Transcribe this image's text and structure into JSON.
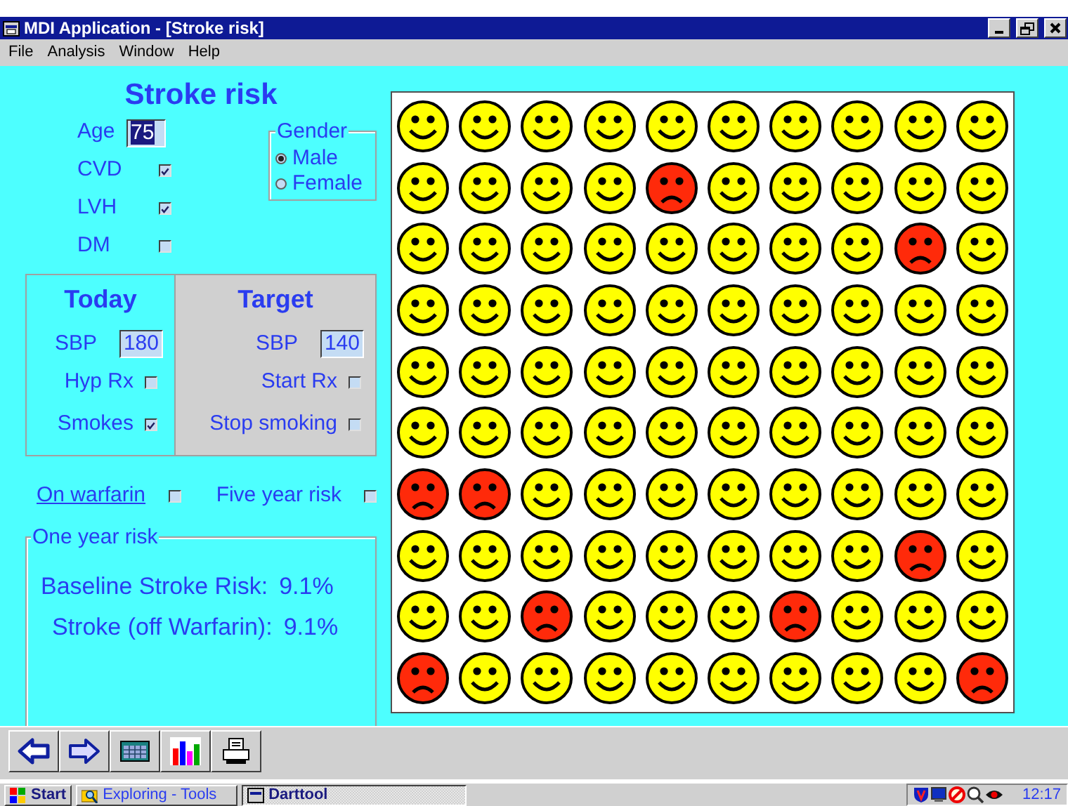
{
  "window": {
    "title": "MDI Application - [Stroke risk]"
  },
  "menu": [
    "File",
    "Analysis",
    "Window",
    "Help"
  ],
  "form": {
    "title": "Stroke risk",
    "age": {
      "label": "Age",
      "value": "75",
      "selected": true
    },
    "conditions": [
      {
        "label": "CVD",
        "checked": true
      },
      {
        "label": "LVH",
        "checked": true
      },
      {
        "label": "DM",
        "checked": false
      }
    ],
    "gender": {
      "legend": "Gender",
      "options": [
        {
          "label": "Male",
          "selected": true
        },
        {
          "label": "Female",
          "selected": false
        }
      ]
    },
    "today": {
      "heading": "Today",
      "sbp": {
        "label": "SBP",
        "value": "180"
      },
      "options": [
        {
          "label": "Hyp Rx",
          "checked": false
        },
        {
          "label": "Smokes",
          "checked": true
        }
      ]
    },
    "target": {
      "heading": "Target",
      "sbp": {
        "label": "SBP",
        "value": "140"
      },
      "options": [
        {
          "label": "Start Rx",
          "checked": false
        },
        {
          "label": "Stop smoking",
          "checked": false
        }
      ]
    },
    "extras": [
      {
        "label": "On warfarin",
        "kind": "link",
        "checked": false
      },
      {
        "label": "Five year risk",
        "kind": "text",
        "checked": false
      }
    ],
    "one_year_risk": {
      "legend": "One year risk",
      "lines": [
        {
          "label": "Baseline Stroke Risk:",
          "value": "9.1%"
        },
        {
          "label": "Stroke (off Warfarin):",
          "value": "9.1%"
        }
      ]
    }
  },
  "faces": [
    [
      {
        "sad": false
      },
      {
        "sad": false
      },
      {
        "sad": false
      },
      {
        "sad": false
      },
      {
        "sad": false
      },
      {
        "sad": false
      },
      {
        "sad": false
      },
      {
        "sad": false
      },
      {
        "sad": false
      },
      {
        "sad": false
      }
    ],
    [
      {
        "sad": false
      },
      {
        "sad": false
      },
      {
        "sad": false
      },
      {
        "sad": false
      },
      {
        "sad": true
      },
      {
        "sad": false
      },
      {
        "sad": false
      },
      {
        "sad": false
      },
      {
        "sad": false
      },
      {
        "sad": false
      }
    ],
    [
      {
        "sad": false
      },
      {
        "sad": false
      },
      {
        "sad": false
      },
      {
        "sad": false
      },
      {
        "sad": false
      },
      {
        "sad": false
      },
      {
        "sad": false
      },
      {
        "sad": false
      },
      {
        "sad": true
      },
      {
        "sad": false
      }
    ],
    [
      {
        "sad": false
      },
      {
        "sad": false
      },
      {
        "sad": false
      },
      {
        "sad": false
      },
      {
        "sad": false
      },
      {
        "sad": false
      },
      {
        "sad": false
      },
      {
        "sad": false
      },
      {
        "sad": false
      },
      {
        "sad": false
      }
    ],
    [
      {
        "sad": false
      },
      {
        "sad": false
      },
      {
        "sad": false
      },
      {
        "sad": false
      },
      {
        "sad": false
      },
      {
        "sad": false
      },
      {
        "sad": false
      },
      {
        "sad": false
      },
      {
        "sad": false
      },
      {
        "sad": false
      }
    ],
    [
      {
        "sad": false
      },
      {
        "sad": false
      },
      {
        "sad": false
      },
      {
        "sad": false
      },
      {
        "sad": false
      },
      {
        "sad": false
      },
      {
        "sad": false
      },
      {
        "sad": false
      },
      {
        "sad": false
      },
      {
        "sad": false
      }
    ],
    [
      {
        "sad": true
      },
      {
        "sad": true
      },
      {
        "sad": false
      },
      {
        "sad": false
      },
      {
        "sad": false
      },
      {
        "sad": false
      },
      {
        "sad": false
      },
      {
        "sad": false
      },
      {
        "sad": false
      },
      {
        "sad": false
      }
    ],
    [
      {
        "sad": false
      },
      {
        "sad": false
      },
      {
        "sad": false
      },
      {
        "sad": false
      },
      {
        "sad": false
      },
      {
        "sad": false
      },
      {
        "sad": false
      },
      {
        "sad": false
      },
      {
        "sad": true
      },
      {
        "sad": false
      }
    ],
    [
      {
        "sad": false
      },
      {
        "sad": false
      },
      {
        "sad": true
      },
      {
        "sad": false
      },
      {
        "sad": false
      },
      {
        "sad": false
      },
      {
        "sad": true
      },
      {
        "sad": false
      },
      {
        "sad": false
      },
      {
        "sad": false
      }
    ],
    [
      {
        "sad": true
      },
      {
        "sad": false
      },
      {
        "sad": false
      },
      {
        "sad": false
      },
      {
        "sad": false
      },
      {
        "sad": false
      },
      {
        "sad": false
      },
      {
        "sad": false
      },
      {
        "sad": false
      },
      {
        "sad": true
      }
    ]
  ],
  "toolbar": [
    {
      "kind": "back"
    },
    {
      "kind": "forward"
    },
    {
      "kind": "calculator"
    },
    {
      "kind": "chart"
    },
    {
      "kind": "print"
    }
  ],
  "taskbar": {
    "start": "Start",
    "tasks": [
      {
        "label": "Exploring - Tools",
        "selected": false
      },
      {
        "label": "Darttool",
        "selected": true
      }
    ],
    "clock": "12:17"
  }
}
